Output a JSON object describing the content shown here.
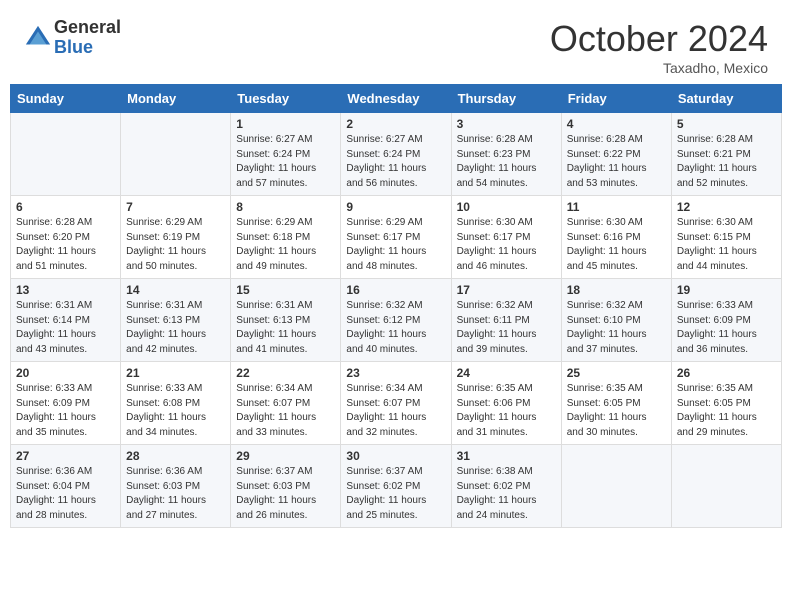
{
  "header": {
    "logo_general": "General",
    "logo_blue": "Blue",
    "month_title": "October 2024",
    "subtitle": "Taxadho, Mexico"
  },
  "days_of_week": [
    "Sunday",
    "Monday",
    "Tuesday",
    "Wednesday",
    "Thursday",
    "Friday",
    "Saturday"
  ],
  "weeks": [
    [
      {
        "day": "",
        "info": ""
      },
      {
        "day": "",
        "info": ""
      },
      {
        "day": "1",
        "info": "Sunrise: 6:27 AM\nSunset: 6:24 PM\nDaylight: 11 hours and 57 minutes."
      },
      {
        "day": "2",
        "info": "Sunrise: 6:27 AM\nSunset: 6:24 PM\nDaylight: 11 hours and 56 minutes."
      },
      {
        "day": "3",
        "info": "Sunrise: 6:28 AM\nSunset: 6:23 PM\nDaylight: 11 hours and 54 minutes."
      },
      {
        "day": "4",
        "info": "Sunrise: 6:28 AM\nSunset: 6:22 PM\nDaylight: 11 hours and 53 minutes."
      },
      {
        "day": "5",
        "info": "Sunrise: 6:28 AM\nSunset: 6:21 PM\nDaylight: 11 hours and 52 minutes."
      }
    ],
    [
      {
        "day": "6",
        "info": "Sunrise: 6:28 AM\nSunset: 6:20 PM\nDaylight: 11 hours and 51 minutes."
      },
      {
        "day": "7",
        "info": "Sunrise: 6:29 AM\nSunset: 6:19 PM\nDaylight: 11 hours and 50 minutes."
      },
      {
        "day": "8",
        "info": "Sunrise: 6:29 AM\nSunset: 6:18 PM\nDaylight: 11 hours and 49 minutes."
      },
      {
        "day": "9",
        "info": "Sunrise: 6:29 AM\nSunset: 6:17 PM\nDaylight: 11 hours and 48 minutes."
      },
      {
        "day": "10",
        "info": "Sunrise: 6:30 AM\nSunset: 6:17 PM\nDaylight: 11 hours and 46 minutes."
      },
      {
        "day": "11",
        "info": "Sunrise: 6:30 AM\nSunset: 6:16 PM\nDaylight: 11 hours and 45 minutes."
      },
      {
        "day": "12",
        "info": "Sunrise: 6:30 AM\nSunset: 6:15 PM\nDaylight: 11 hours and 44 minutes."
      }
    ],
    [
      {
        "day": "13",
        "info": "Sunrise: 6:31 AM\nSunset: 6:14 PM\nDaylight: 11 hours and 43 minutes."
      },
      {
        "day": "14",
        "info": "Sunrise: 6:31 AM\nSunset: 6:13 PM\nDaylight: 11 hours and 42 minutes."
      },
      {
        "day": "15",
        "info": "Sunrise: 6:31 AM\nSunset: 6:13 PM\nDaylight: 11 hours and 41 minutes."
      },
      {
        "day": "16",
        "info": "Sunrise: 6:32 AM\nSunset: 6:12 PM\nDaylight: 11 hours and 40 minutes."
      },
      {
        "day": "17",
        "info": "Sunrise: 6:32 AM\nSunset: 6:11 PM\nDaylight: 11 hours and 39 minutes."
      },
      {
        "day": "18",
        "info": "Sunrise: 6:32 AM\nSunset: 6:10 PM\nDaylight: 11 hours and 37 minutes."
      },
      {
        "day": "19",
        "info": "Sunrise: 6:33 AM\nSunset: 6:09 PM\nDaylight: 11 hours and 36 minutes."
      }
    ],
    [
      {
        "day": "20",
        "info": "Sunrise: 6:33 AM\nSunset: 6:09 PM\nDaylight: 11 hours and 35 minutes."
      },
      {
        "day": "21",
        "info": "Sunrise: 6:33 AM\nSunset: 6:08 PM\nDaylight: 11 hours and 34 minutes."
      },
      {
        "day": "22",
        "info": "Sunrise: 6:34 AM\nSunset: 6:07 PM\nDaylight: 11 hours and 33 minutes."
      },
      {
        "day": "23",
        "info": "Sunrise: 6:34 AM\nSunset: 6:07 PM\nDaylight: 11 hours and 32 minutes."
      },
      {
        "day": "24",
        "info": "Sunrise: 6:35 AM\nSunset: 6:06 PM\nDaylight: 11 hours and 31 minutes."
      },
      {
        "day": "25",
        "info": "Sunrise: 6:35 AM\nSunset: 6:05 PM\nDaylight: 11 hours and 30 minutes."
      },
      {
        "day": "26",
        "info": "Sunrise: 6:35 AM\nSunset: 6:05 PM\nDaylight: 11 hours and 29 minutes."
      }
    ],
    [
      {
        "day": "27",
        "info": "Sunrise: 6:36 AM\nSunset: 6:04 PM\nDaylight: 11 hours and 28 minutes."
      },
      {
        "day": "28",
        "info": "Sunrise: 6:36 AM\nSunset: 6:03 PM\nDaylight: 11 hours and 27 minutes."
      },
      {
        "day": "29",
        "info": "Sunrise: 6:37 AM\nSunset: 6:03 PM\nDaylight: 11 hours and 26 minutes."
      },
      {
        "day": "30",
        "info": "Sunrise: 6:37 AM\nSunset: 6:02 PM\nDaylight: 11 hours and 25 minutes."
      },
      {
        "day": "31",
        "info": "Sunrise: 6:38 AM\nSunset: 6:02 PM\nDaylight: 11 hours and 24 minutes."
      },
      {
        "day": "",
        "info": ""
      },
      {
        "day": "",
        "info": ""
      }
    ]
  ]
}
